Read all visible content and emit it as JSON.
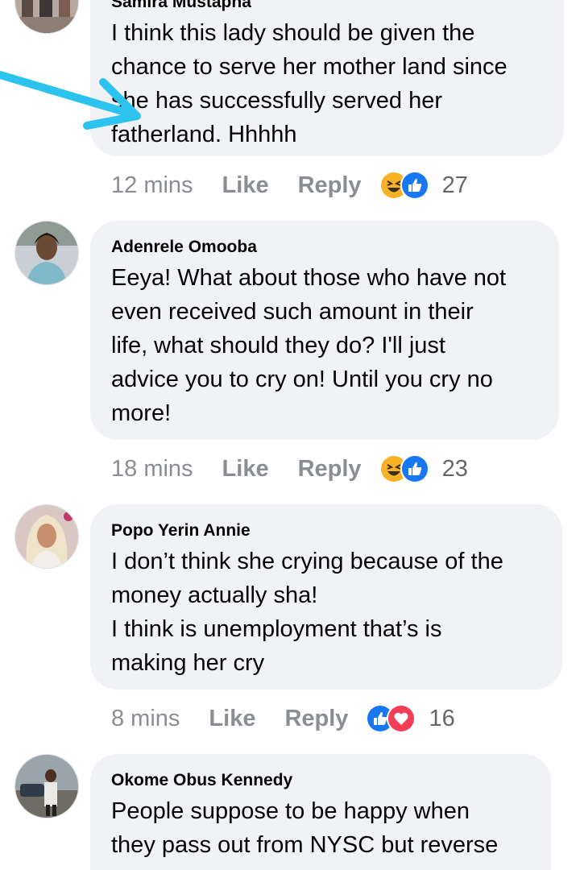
{
  "comments": [
    {
      "author": "Samira Mustapha",
      "lines": [
        "I think this lady should be given the",
        "chance to serve her mother land since",
        "she has successfully served her",
        "fatherland. Hhhhh"
      ],
      "time": "12 mins",
      "like_label": "Like",
      "reply_label": "Reply",
      "reactions": [
        "haha-icon",
        "like-icon"
      ],
      "reaction_count": "27"
    },
    {
      "author": "Adenrele Omooba",
      "lines": [
        "Eeya! What about those who have not",
        "even received such amount in their",
        "life, what should they do? I'll just",
        "advice you to cry on! Until you cry no",
        "more!"
      ],
      "time": "18 mins",
      "like_label": "Like",
      "reply_label": "Reply",
      "reactions": [
        "haha-icon",
        "like-icon"
      ],
      "reaction_count": "23"
    },
    {
      "author": "Popo Yerin Annie",
      "lines": [
        "I don’t think she crying because of the",
        "money actually sha!",
        "I think is unemployment that’s is",
        "making her cry"
      ],
      "time": "8 mins",
      "like_label": "Like",
      "reply_label": "Reply",
      "reactions": [
        "like-icon",
        "love-icon"
      ],
      "reaction_count": "16"
    },
    {
      "author": "Okome Obus Kennedy",
      "lines": [
        "People suppose to be happy when",
        "they pass out from NYSC but reverse"
      ]
    }
  ],
  "colors": {
    "bubble": "#f0f2f5",
    "meta_text": "#8a8d91",
    "like_blue": "#1877f2",
    "love_red": "#f33e58",
    "haha_yellow": "#f7b125",
    "arrow": "#2cc3ee"
  }
}
